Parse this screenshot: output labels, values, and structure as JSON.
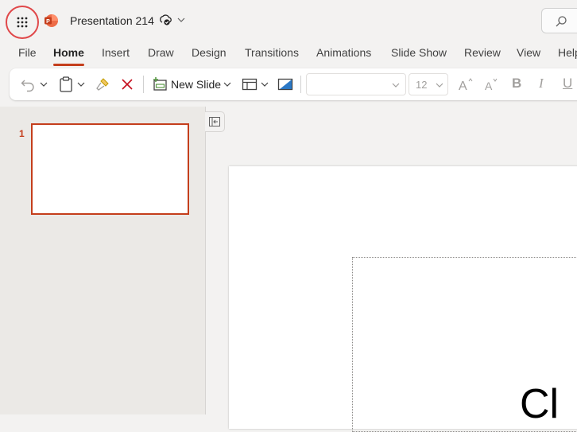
{
  "app": {
    "title": "Presentation 214",
    "brand_color": "#c43e1c",
    "highlight_ring_color": "#e0484a"
  },
  "titlebar": {
    "app_launcher_icon": "waffle-grid-icon",
    "app_icon": "powerpoint-icon",
    "sync_icon": "cloud-sync-icon",
    "search_icon": "search-icon"
  },
  "menu": {
    "tabs": [
      "File",
      "Home",
      "Insert",
      "Draw",
      "Design",
      "Transitions",
      "Animations",
      "Slide Show",
      "Review",
      "View",
      "Help"
    ],
    "active": "Home"
  },
  "ribbon": {
    "new_slide_label": "New Slide",
    "font_name": "",
    "font_size": "12",
    "format_letters": [
      "B",
      "I",
      "U"
    ]
  },
  "slides": {
    "current_number": "1"
  },
  "canvas": {
    "placeholder_text": "Cl"
  }
}
